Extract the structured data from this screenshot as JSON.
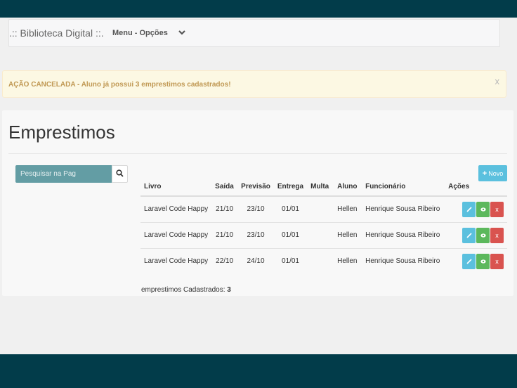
{
  "navbar": {
    "brand": ".:: Biblioteca Digital ::.",
    "menu_label": "Menu - Opções",
    "menu_icon": "chevron-down-icon"
  },
  "alert": {
    "message": "AÇÃO CANCELADA - Aluno já possui 3 emprestimos cadastrados!",
    "close": "x"
  },
  "page": {
    "title": "Emprestimos"
  },
  "search": {
    "placeholder": "Pesquisar na Pag",
    "icon": "search-icon"
  },
  "buttons": {
    "novo_plus": "+",
    "novo": "Novo"
  },
  "table": {
    "columns": [
      "Livro",
      "Saída",
      "Previsão",
      "Entrega",
      "Multa",
      "Aluno",
      "Funcionário",
      "Ações"
    ],
    "rows": [
      {
        "livro": "Laravel Code Happy",
        "saida": "21/10",
        "previsao": "23/10",
        "entrega": "01/01",
        "multa": "",
        "aluno": "Hellen",
        "funcionario": "Henrique Sousa Ribeiro"
      },
      {
        "livro": "Laravel Code Happy",
        "saida": "21/10",
        "previsao": "23/10",
        "entrega": "01/01",
        "multa": "",
        "aluno": "Hellen",
        "funcionario": "Henrique Sousa Ribeiro"
      },
      {
        "livro": "Laravel Code Happy",
        "saida": "22/10",
        "previsao": "24/10",
        "entrega": "01/01",
        "multa": "",
        "aluno": "Hellen",
        "funcionario": "Henrique Sousa Ribeiro"
      }
    ],
    "action_delete": "x"
  },
  "footer": {
    "count_label": "emprestimos Cadastrados:",
    "count_value": "3"
  },
  "colors": {
    "topbar": "#023c4a",
    "alert_text": "#c09853",
    "search_bg": "#639da4",
    "edit": "#5bc0de",
    "view": "#5cb85c",
    "delete": "#d9534f"
  }
}
